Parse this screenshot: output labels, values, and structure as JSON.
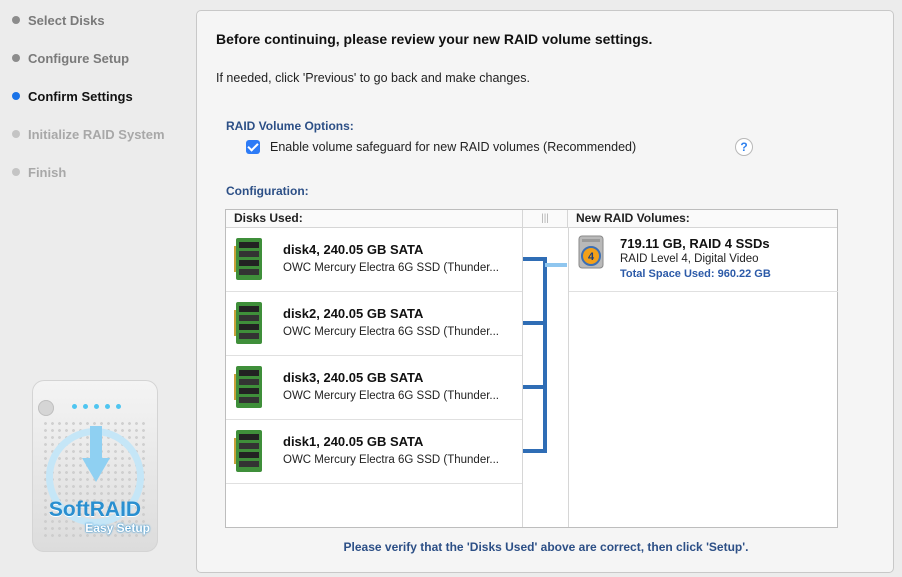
{
  "sidebar": {
    "steps": [
      {
        "label": "Select Disks",
        "state": "done"
      },
      {
        "label": "Configure Setup",
        "state": "done"
      },
      {
        "label": "Confirm Settings",
        "state": "current"
      },
      {
        "label": "Initialize RAID System",
        "state": "todo"
      },
      {
        "label": "Finish",
        "state": "todo"
      }
    ],
    "logo": {
      "title": "SoftRAID",
      "subtitle": "Easy Setup"
    }
  },
  "main": {
    "heading": "Before continuing, please review your new RAID volume settings.",
    "subtext": "If needed, click 'Previous' to go back and make changes.",
    "raid_options": {
      "title": "RAID Volume Options:",
      "checkbox_label": "Enable volume safeguard for new RAID volumes  (Recommended)",
      "checked": true,
      "help_label": "?"
    },
    "configuration": {
      "title": "Configuration:",
      "disks_header": "Disks Used:",
      "mid_header": "|||",
      "volumes_header": "New RAID Volumes:",
      "disks": [
        {
          "name": "disk4, 240.05 GB SATA",
          "desc": "OWC Mercury Electra 6G SSD (Thunder..."
        },
        {
          "name": "disk2, 240.05 GB SATA",
          "desc": "OWC Mercury Electra 6G SSD (Thunder..."
        },
        {
          "name": "disk3, 240.05 GB SATA",
          "desc": "OWC Mercury Electra 6G SSD (Thunder..."
        },
        {
          "name": "disk1, 240.05 GB SATA",
          "desc": "OWC Mercury Electra 6G SSD (Thunder..."
        }
      ],
      "volumes": [
        {
          "title": "719.11 GB, RAID 4 SSDs",
          "subtitle": "RAID Level 4, Digital Video",
          "space": "Total Space Used: 960.22 GB",
          "level_badge": "4"
        }
      ]
    },
    "footer_note": "Please verify that the 'Disks Used' above are correct, then click 'Setup'."
  },
  "colors": {
    "accent": "#1a73e8",
    "section_title": "#2c4f86",
    "connector": "#2f6db5",
    "connector_light": "#8fc6ef"
  }
}
